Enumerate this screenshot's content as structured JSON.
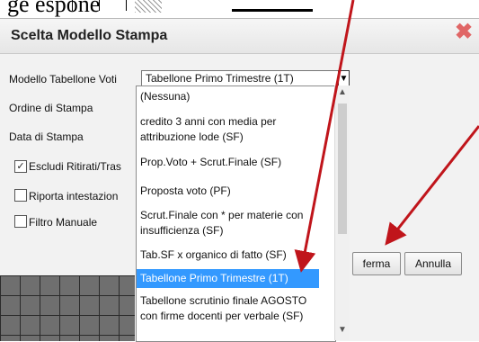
{
  "header_fragment": "ge espone",
  "dialog": {
    "title": "Scelta Modello Stampa",
    "close_icon": "close-x-icon"
  },
  "form": {
    "modello_label": "Modello Tabellone Voti",
    "modello_value": "Tabellone Primo Trimestre (1T)",
    "ordine_label": "Ordine di Stampa",
    "data_label": "Data di Stampa",
    "escludi_label": "Escludi Ritirati/Tras",
    "escludi_checked": true,
    "riporta_label": "Riporta intestazion",
    "riporta_checked": false,
    "filtro_label": "Filtro Manuale",
    "filtro_checked": false
  },
  "dropdown": {
    "options": [
      "(Nessuna)",
      "credito 3 anni con media per attribuzione lode (SF)",
      "Prop.Voto + Scrut.Finale (SF)",
      "Proposta voto (PF)",
      "Scrut.Finale con * per materie con insufficienza (SF)",
      "Tab.SF x organico di fatto (SF)",
      "Tabellone Primo Trimestre (1T)",
      "Tabellone scrutinio finale AGOSTO con firme docenti per verbale (SF)"
    ],
    "selected_index": 6
  },
  "buttons": {
    "conferma_label": "ferma",
    "annulla_label": "Annulla"
  },
  "colors": {
    "selection": "#3399ff",
    "annotation_arrow": "#c0151b",
    "close_icon": "#e06666"
  }
}
